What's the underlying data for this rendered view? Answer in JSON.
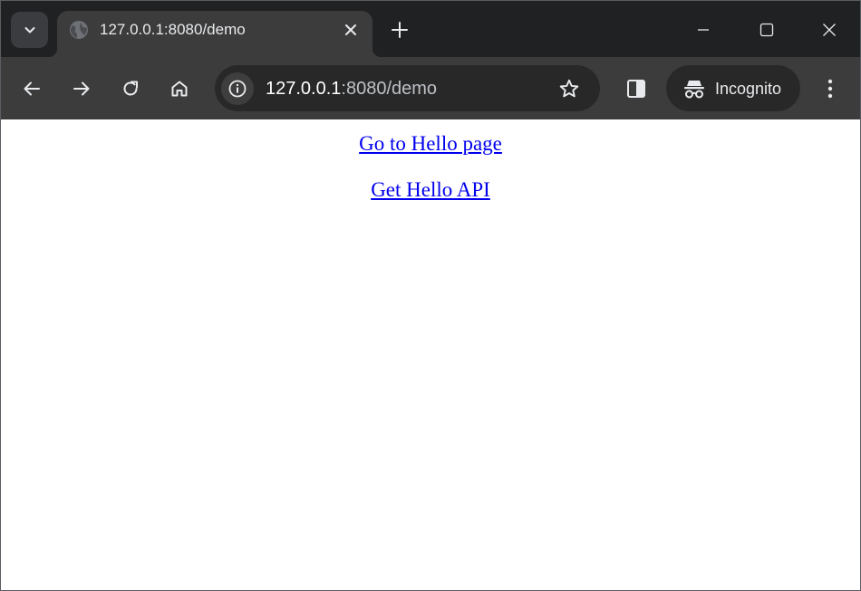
{
  "browser": {
    "tab": {
      "title": "127.0.0.1:8080/demo",
      "favicon": "globe-icon"
    },
    "window_controls": [
      "minimize-icon",
      "maximize-icon",
      "close-icon"
    ],
    "address_bar": {
      "host": "127.0.0.1",
      "rest": ":8080/demo"
    },
    "profile": {
      "label": "Incognito",
      "icon": "incognito-icon"
    },
    "colors": {
      "frame": "#1f2123",
      "toolbar": "#3c3c3c",
      "omnibox": "#282828"
    }
  },
  "page": {
    "links": [
      {
        "label": "Go to Hello page"
      },
      {
        "label": "Get Hello API"
      }
    ],
    "link_color": "#0000ee"
  }
}
